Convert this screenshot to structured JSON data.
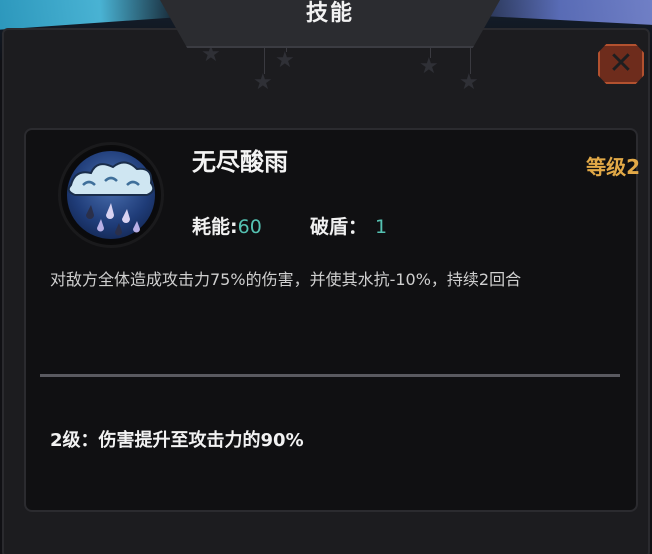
{
  "window": {
    "title": "技能"
  },
  "close": {
    "icon": "close-icon"
  },
  "skill": {
    "icon": "acid-rain-cloud-icon",
    "name": "无尽酸雨",
    "level_label": "等级2",
    "energy_label": "耗能:",
    "energy_value": "60",
    "break_label": "破盾：",
    "break_value": "1",
    "description": "对敌方全体造成攻击力75%的伤害，并使其水抗-10%，持续2回合",
    "upgrade_text": "2级：伤害提升至攻击力的90%"
  },
  "colors": {
    "level": "#e2a947",
    "stat_value": "#55c2b2",
    "close_fill": "#6e2c1c",
    "close_border": "#b2512f"
  }
}
